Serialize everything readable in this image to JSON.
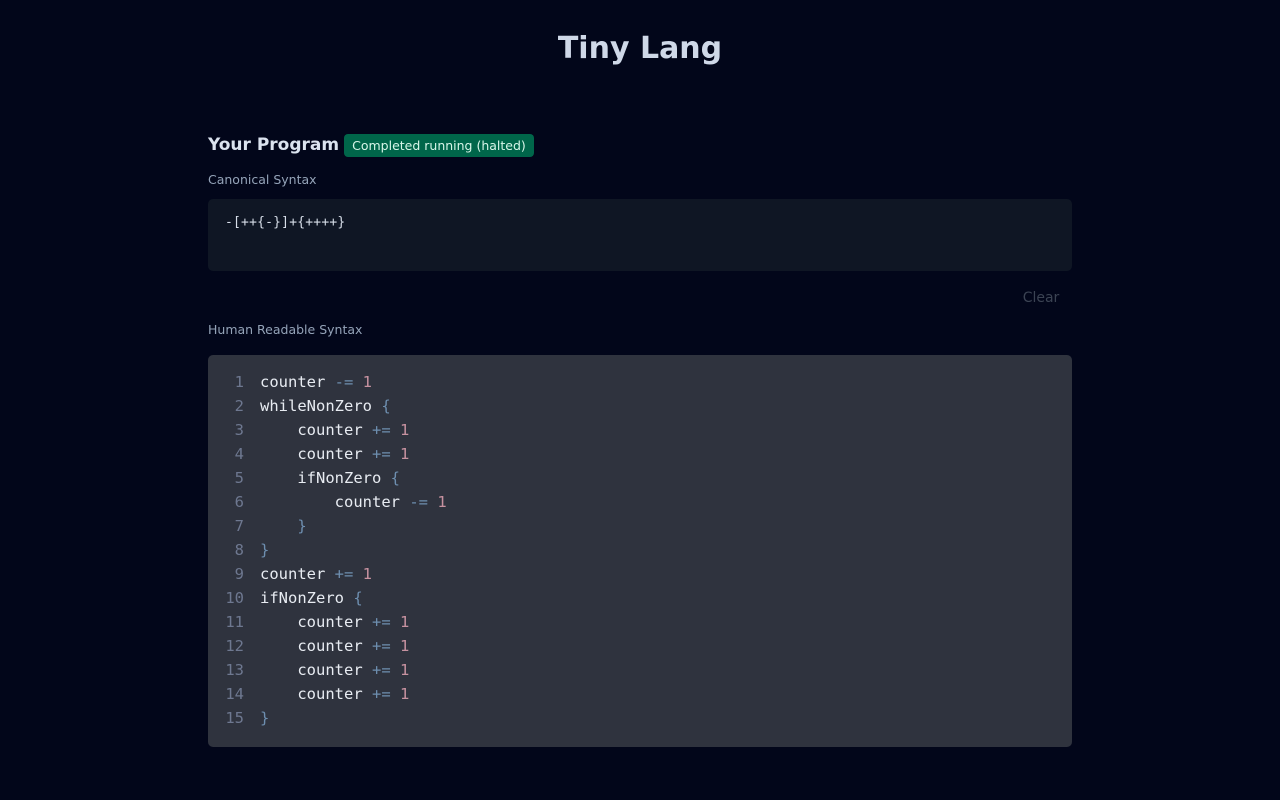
{
  "app": {
    "title": "Tiny Lang"
  },
  "program": {
    "heading": "Your Program",
    "status": "Completed running (halted)",
    "status_color": "#00664a"
  },
  "canonical": {
    "label": "Canonical Syntax",
    "code": "-[++{-}]+{++++}"
  },
  "actions": {
    "clear_label": "Clear"
  },
  "readable": {
    "label": "Human Readable Syntax",
    "lines": [
      {
        "number": "1",
        "indent": "",
        "tokens": [
          {
            "t": "ident",
            "v": "counter"
          },
          {
            "t": "op",
            "v": " -= "
          },
          {
            "t": "num",
            "v": "1"
          }
        ]
      },
      {
        "number": "2",
        "indent": "",
        "tokens": [
          {
            "t": "ident",
            "v": "whileNonZero"
          },
          {
            "t": "brace",
            "v": " {"
          }
        ]
      },
      {
        "number": "3",
        "indent": "    ",
        "tokens": [
          {
            "t": "ident",
            "v": "counter"
          },
          {
            "t": "op",
            "v": " += "
          },
          {
            "t": "num",
            "v": "1"
          }
        ]
      },
      {
        "number": "4",
        "indent": "    ",
        "tokens": [
          {
            "t": "ident",
            "v": "counter"
          },
          {
            "t": "op",
            "v": " += "
          },
          {
            "t": "num",
            "v": "1"
          }
        ]
      },
      {
        "number": "5",
        "indent": "    ",
        "tokens": [
          {
            "t": "ident",
            "v": "ifNonZero"
          },
          {
            "t": "brace",
            "v": " {"
          }
        ]
      },
      {
        "number": "6",
        "indent": "        ",
        "tokens": [
          {
            "t": "ident",
            "v": "counter"
          },
          {
            "t": "op",
            "v": " -= "
          },
          {
            "t": "num",
            "v": "1"
          }
        ]
      },
      {
        "number": "7",
        "indent": "    ",
        "tokens": [
          {
            "t": "brace",
            "v": "}"
          }
        ]
      },
      {
        "number": "8",
        "indent": "",
        "tokens": [
          {
            "t": "brace",
            "v": "}"
          }
        ]
      },
      {
        "number": "9",
        "indent": "",
        "tokens": [
          {
            "t": "ident",
            "v": "counter"
          },
          {
            "t": "op",
            "v": " += "
          },
          {
            "t": "num",
            "v": "1"
          }
        ]
      },
      {
        "number": "10",
        "indent": "",
        "tokens": [
          {
            "t": "ident",
            "v": "ifNonZero"
          },
          {
            "t": "brace",
            "v": " {"
          }
        ]
      },
      {
        "number": "11",
        "indent": "    ",
        "tokens": [
          {
            "t": "ident",
            "v": "counter"
          },
          {
            "t": "op",
            "v": " += "
          },
          {
            "t": "num",
            "v": "1"
          }
        ]
      },
      {
        "number": "12",
        "indent": "    ",
        "tokens": [
          {
            "t": "ident",
            "v": "counter"
          },
          {
            "t": "op",
            "v": " += "
          },
          {
            "t": "num",
            "v": "1"
          }
        ]
      },
      {
        "number": "13",
        "indent": "    ",
        "tokens": [
          {
            "t": "ident",
            "v": "counter"
          },
          {
            "t": "op",
            "v": " += "
          },
          {
            "t": "num",
            "v": "1"
          }
        ]
      },
      {
        "number": "14",
        "indent": "    ",
        "tokens": [
          {
            "t": "ident",
            "v": "counter"
          },
          {
            "t": "op",
            "v": " += "
          },
          {
            "t": "num",
            "v": "1"
          }
        ]
      },
      {
        "number": "15",
        "indent": "",
        "tokens": [
          {
            "t": "brace",
            "v": "}"
          }
        ]
      }
    ]
  }
}
